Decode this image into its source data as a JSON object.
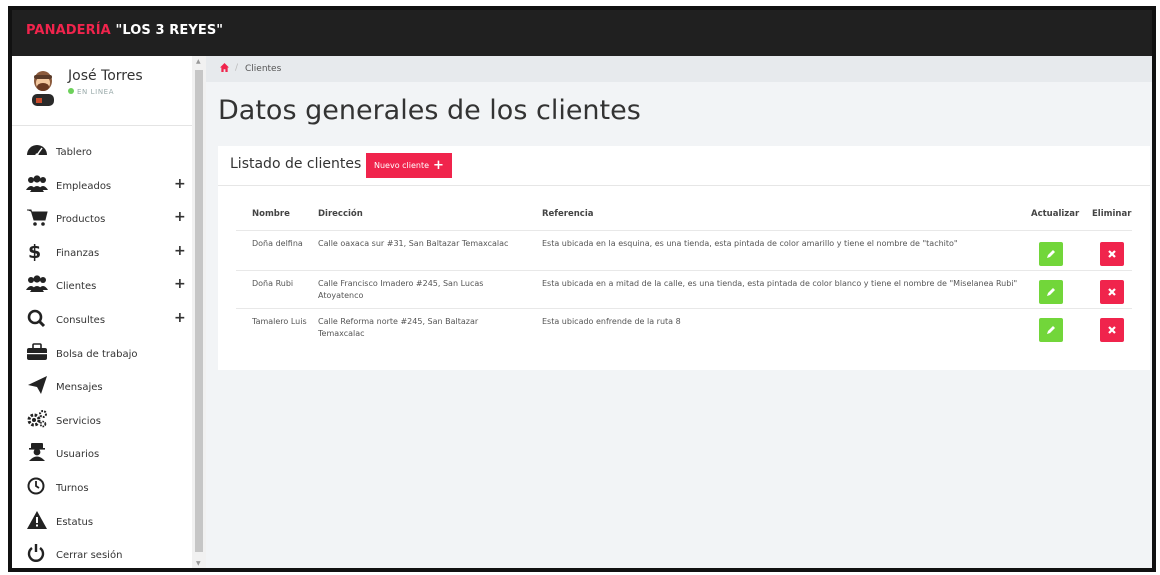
{
  "brand": {
    "part1": "PANADERÍA ",
    "part2": "\"LOS 3 REYES\""
  },
  "user": {
    "name": "José Torres",
    "status": "EN LINEA"
  },
  "menu": [
    {
      "label": "Tablero",
      "icon": "dashboard-icon",
      "has_plus": false
    },
    {
      "label": "Empleados",
      "icon": "users-icon",
      "has_plus": true
    },
    {
      "label": "Productos",
      "icon": "cart-icon",
      "has_plus": true
    },
    {
      "label": "Finanzas",
      "icon": "dollar-icon",
      "has_plus": true
    },
    {
      "label": "Clientes",
      "icon": "users-icon",
      "has_plus": true
    },
    {
      "label": "Consultes",
      "icon": "search-icon",
      "has_plus": true
    },
    {
      "label": "Bolsa de trabajo",
      "icon": "briefcase-icon",
      "has_plus": false
    },
    {
      "label": "Mensajes",
      "icon": "paper-plane-icon",
      "has_plus": false
    },
    {
      "label": "Servicios",
      "icon": "gears-icon",
      "has_plus": false
    },
    {
      "label": "Usuarios",
      "icon": "user-secret-icon",
      "has_plus": false
    },
    {
      "label": "Turnos",
      "icon": "clock-icon",
      "has_plus": false
    },
    {
      "label": "Estatus",
      "icon": "warning-icon",
      "has_plus": false
    },
    {
      "label": "Cerrar sesión",
      "icon": "power-icon",
      "has_plus": false
    }
  ],
  "breadcrumb": {
    "current": "Clientes",
    "separator": "/"
  },
  "page_title": "Datos generales de los clientes",
  "card": {
    "title": "Listado de clientes",
    "new_button": "Nuevo cliente",
    "new_button_plus": "+"
  },
  "table": {
    "headers": {
      "nombre": "Nombre",
      "direccion": "Dirección",
      "referencia": "Referencia",
      "actualizar": "Actualizar",
      "eliminar": "Eliminar"
    },
    "rows": [
      {
        "nombre": "Doña delfina",
        "direccion": "Calle oaxaca sur #31, San Baltazar Temaxcalac",
        "referencia": "Esta ubicada en la esquina, es una tienda, esta pintada de color amarillo y tiene el nombre de \"tachito\""
      },
      {
        "nombre": "Doña Rubi",
        "direccion": "Calle Francisco Imadero #245, San Lucas Atoyatenco",
        "referencia": "Esta ubicada en a mitad de la calle, es una tienda, esta pintada de color blanco y tiene el nombre de \"Miselanea Rubi\""
      },
      {
        "nombre": "Tamalero Luis",
        "direccion": "Calle Reforma norte #245, San Baltazar Temaxcalac",
        "referencia": "Esta ubicado enfrende de la ruta 8"
      }
    ]
  },
  "colors": {
    "accent": "#f0244c",
    "topbar": "#202020",
    "edit": "#72d63a",
    "online": "#6cd15a"
  }
}
